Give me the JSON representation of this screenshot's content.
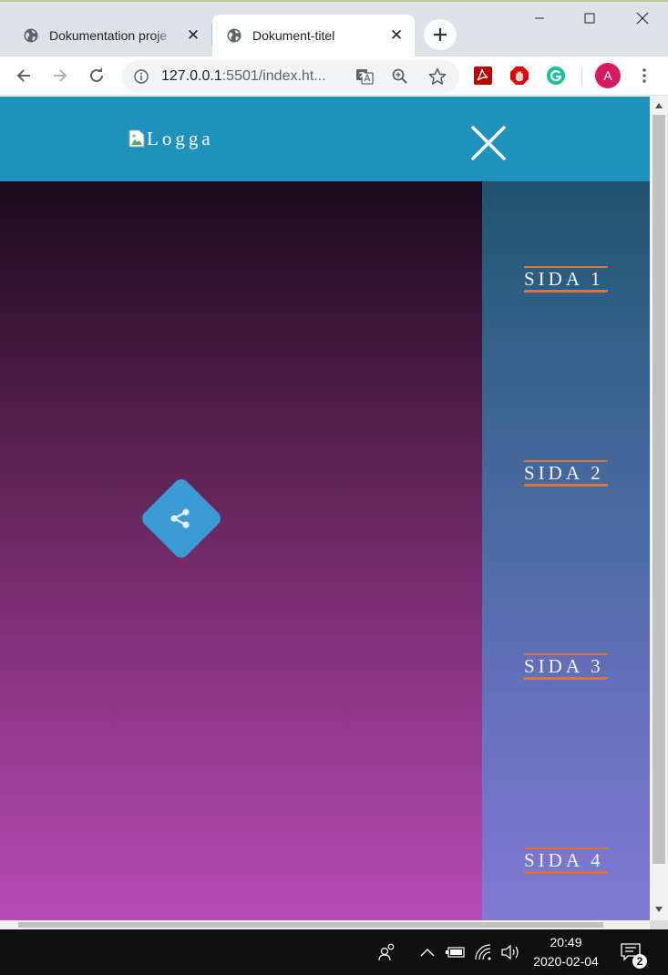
{
  "browser": {
    "tabs": [
      {
        "title": "Dokumentation proje",
        "active": false,
        "icon": "globe-icon"
      },
      {
        "title": "Dokument-titel",
        "active": true,
        "icon": "globe-icon"
      }
    ],
    "url_host": "127.0.0.1",
    "url_rest": ":5501/index.ht...",
    "profile_initial": "A"
  },
  "site": {
    "logo_alt": "Logga",
    "nav": [
      "SIDA 1",
      "SIDA 2",
      "SIDA 3",
      "SIDA 4"
    ],
    "header_color": "#1e91bc",
    "accent_underline": "#d8743c",
    "share_button_color": "#3a9bd5"
  },
  "taskbar": {
    "time": "20:49",
    "date": "2020-02-04",
    "notification_count": "2"
  }
}
